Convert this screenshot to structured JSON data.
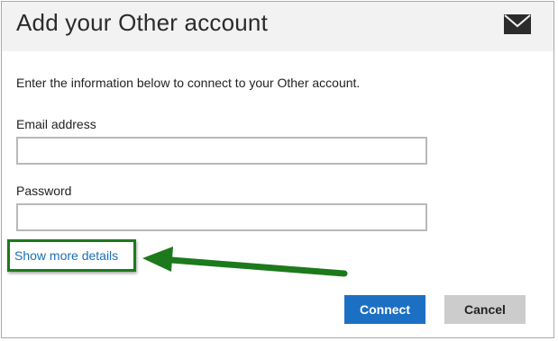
{
  "dialog": {
    "title": "Add your Other account",
    "instructions": "Enter the information below to connect to your Other account."
  },
  "form": {
    "email_label": "Email address",
    "email_value": "",
    "password_label": "Password",
    "password_value": ""
  },
  "links": {
    "show_more_details": "Show more details"
  },
  "buttons": {
    "connect": "Connect",
    "cancel": "Cancel"
  },
  "icons": {
    "header": "mail-icon",
    "annotation": "arrow-annotation-icon"
  },
  "colors": {
    "accent": "#1c70c4",
    "link": "#1a6fb5",
    "annotation": "#1c7a1c",
    "header_bg": "#f2f2f2"
  }
}
